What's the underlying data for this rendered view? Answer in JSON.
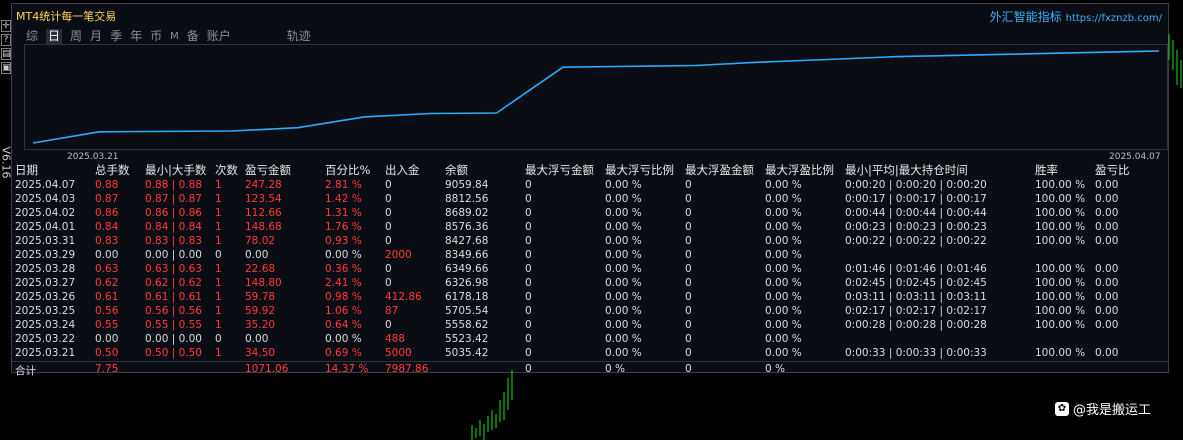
{
  "window": {
    "title": "MT4统计每一笔交易",
    "brand": "外汇智能指标",
    "brand_url": "https://fxznzb.com/",
    "version": "V6.16"
  },
  "left_toolbar": [
    {
      "icon": "crosshair-icon",
      "glyph": "✛"
    },
    {
      "icon": "help-icon",
      "glyph": "?"
    },
    {
      "icon": "chart-icon",
      "glyph": "▤"
    },
    {
      "icon": "period-icon",
      "glyph": "▣"
    }
  ],
  "tabs": [
    {
      "label": "综",
      "active": false
    },
    {
      "label": "日",
      "active": true
    },
    {
      "label": "周",
      "active": false
    },
    {
      "label": "月",
      "active": false
    },
    {
      "label": "季",
      "active": false
    },
    {
      "label": "年",
      "active": false
    },
    {
      "label": "币",
      "active": false
    },
    {
      "label": "M",
      "active": false
    },
    {
      "label": "备",
      "active": false
    },
    {
      "label": "账户",
      "active": false
    },
    {
      "label": "轨迹",
      "active": false
    }
  ],
  "chart_data": {
    "type": "line",
    "x_labels": [
      "2025.03.21",
      "2025.04.07"
    ],
    "x": [
      "2025.03.21",
      "2025.03.22",
      "2025.03.24",
      "2025.03.25",
      "2025.03.26",
      "2025.03.27",
      "2025.03.28",
      "2025.03.29",
      "2025.03.31",
      "2025.04.01",
      "2025.04.02",
      "2025.04.03",
      "2025.04.07"
    ],
    "values": [
      5035.42,
      5523.42,
      5558.62,
      5705.54,
      6178.18,
      6326.98,
      6349.66,
      8349.66,
      8427.68,
      8576.36,
      8689.02,
      8812.56,
      9059.84
    ],
    "line_color": "#2eaaff"
  },
  "table": {
    "headers": [
      "日期",
      "总手数",
      "最小|大手数",
      "次数",
      "盈亏金额",
      "百分比%",
      "出入金",
      "余额",
      "最大浮亏金额",
      "最大浮亏比例",
      "最大浮盈金额",
      "最大浮盈比例",
      "最小|平均|最大持仓时间",
      "胜率",
      "盈亏比"
    ],
    "rows": [
      {
        "red": true,
        "cells": [
          "2025.04.07",
          "0.88",
          "0.88 | 0.88",
          "1",
          "247.28",
          "2.81 %",
          "0",
          "9059.84",
          "0",
          "0.00 %",
          "0",
          "0.00 %",
          "0:00:20 | 0:00:20 | 0:00:20",
          "100.00 %",
          "0.00"
        ]
      },
      {
        "red": true,
        "cells": [
          "2025.04.03",
          "0.87",
          "0.87 | 0.87",
          "1",
          "123.54",
          "1.42 %",
          "0",
          "8812.56",
          "0",
          "0.00 %",
          "0",
          "0.00 %",
          "0:00:17 | 0:00:17 | 0:00:17",
          "100.00 %",
          "0.00"
        ]
      },
      {
        "red": true,
        "cells": [
          "2025.04.02",
          "0.86",
          "0.86 | 0.86",
          "1",
          "112.66",
          "1.31 %",
          "0",
          "8689.02",
          "0",
          "0.00 %",
          "0",
          "0.00 %",
          "0:00:44 | 0:00:44 | 0:00:44",
          "100.00 %",
          "0.00"
        ]
      },
      {
        "red": true,
        "cells": [
          "2025.04.01",
          "0.84",
          "0.84 | 0.84",
          "1",
          "148.68",
          "1.76 %",
          "0",
          "8576.36",
          "0",
          "0.00 %",
          "0",
          "0.00 %",
          "0:00:23 | 0:00:23 | 0:00:23",
          "100.00 %",
          "0.00"
        ]
      },
      {
        "red": true,
        "cells": [
          "2025.03.31",
          "0.83",
          "0.83 | 0.83",
          "1",
          "78.02",
          "0.93 %",
          "0",
          "8427.68",
          "0",
          "0.00 %",
          "0",
          "0.00 %",
          "0:00:22 | 0:00:22 | 0:00:22",
          "100.00 %",
          "0.00"
        ]
      },
      {
        "red": false,
        "cells": [
          "2025.03.29",
          "0.00",
          "0.00 | 0.00",
          "0",
          "0.00",
          "0.00 %",
          "2000",
          "8349.66",
          "0",
          "0.00 %",
          "0",
          "0.00 %",
          "",
          "",
          ""
        ]
      },
      {
        "red": true,
        "cells": [
          "2025.03.28",
          "0.63",
          "0.63 | 0.63",
          "1",
          "22.68",
          "0.36 %",
          "0",
          "6349.66",
          "0",
          "0.00 %",
          "0",
          "0.00 %",
          "0:01:46 | 0:01:46 | 0:01:46",
          "100.00 %",
          "0.00"
        ]
      },
      {
        "red": true,
        "cells": [
          "2025.03.27",
          "0.62",
          "0.62 | 0.62",
          "1",
          "148.80",
          "2.41 %",
          "0",
          "6326.98",
          "0",
          "0.00 %",
          "0",
          "0.00 %",
          "0:02:45 | 0:02:45 | 0:02:45",
          "100.00 %",
          "0.00"
        ]
      },
      {
        "red": true,
        "cells": [
          "2025.03.26",
          "0.61",
          "0.61 | 0.61",
          "1",
          "59.78",
          "0.98 %",
          "412.86",
          "6178.18",
          "0",
          "0.00 %",
          "0",
          "0.00 %",
          "0:03:11 | 0:03:11 | 0:03:11",
          "100.00 %",
          "0.00"
        ]
      },
      {
        "red": true,
        "cells": [
          "2025.03.25",
          "0.56",
          "0.56 | 0.56",
          "1",
          "59.92",
          "1.06 %",
          "87",
          "5705.54",
          "0",
          "0.00 %",
          "0",
          "0.00 %",
          "0:02:17 | 0:02:17 | 0:02:17",
          "100.00 %",
          "0.00"
        ]
      },
      {
        "red": true,
        "cells": [
          "2025.03.24",
          "0.55",
          "0.55 | 0.55",
          "1",
          "35.20",
          "0.64 %",
          "0",
          "5558.62",
          "0",
          "0.00 %",
          "0",
          "0.00 %",
          "0:00:28 | 0:00:28 | 0:00:28",
          "100.00 %",
          "0.00"
        ]
      },
      {
        "red": false,
        "cells": [
          "2025.03.22",
          "0.00",
          "0.00 | 0.00",
          "0",
          "0.00",
          "0.00 %",
          "488",
          "5523.42",
          "0",
          "0.00 %",
          "0",
          "0.00 %",
          "",
          "",
          ""
        ]
      },
      {
        "red": true,
        "cells": [
          "2025.03.21",
          "0.50",
          "0.50 | 0.50",
          "1",
          "34.50",
          "0.69 %",
          "5000",
          "5035.42",
          "0",
          "0.00 %",
          "0",
          "0.00 %",
          "0:00:33 | 0:00:33 | 0:00:33",
          "100.00 %",
          "0.00"
        ]
      }
    ],
    "total": [
      "合计",
      "7.75",
      "",
      "",
      "1071.06",
      "14.37 %",
      "7987.86",
      "",
      "0",
      "0 %",
      "0",
      "0 %",
      "",
      "",
      ""
    ]
  },
  "watermark": {
    "icon": "logo-icon",
    "text": "@我是搬运工"
  }
}
